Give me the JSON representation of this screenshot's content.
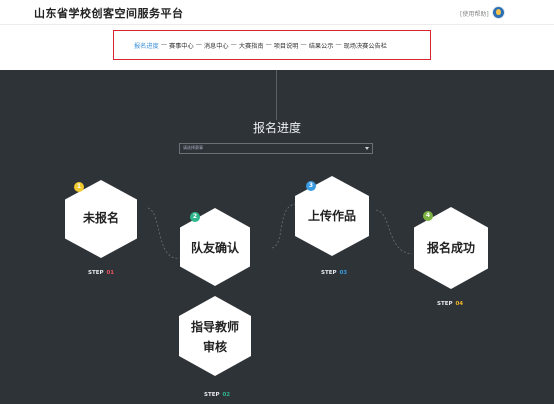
{
  "header": {
    "site_title": "山东省学校创客空间服务平台",
    "help_link": "[使用帮助]"
  },
  "nav": {
    "items": [
      {
        "label": "报名进度",
        "active": true
      },
      {
        "label": "赛事中心",
        "active": false
      },
      {
        "label": "消息中心",
        "active": false
      },
      {
        "label": "大赛指南",
        "active": false
      },
      {
        "label": "项目说明",
        "active": false
      },
      {
        "label": "结果公示",
        "active": false
      },
      {
        "label": "现场决赛公告栏",
        "active": false
      }
    ],
    "separator": "—",
    "highlight_color": "#d8262c"
  },
  "main": {
    "section_title": "报名进度",
    "select_placeholder": "请选择赛事"
  },
  "steps": [
    {
      "badge": "1",
      "label_lines": [
        "未报名"
      ],
      "step_word": "STEP",
      "step_num": "01",
      "badge_color": "#f0c92f",
      "num_color": "#e8505b"
    },
    {
      "badge": "2",
      "label_lines": [
        "队友确认"
      ],
      "step_word": "STEP",
      "step_num": "",
      "badge_color": "#2fb48c",
      "num_color": "#2fb48c"
    },
    {
      "badge": "",
      "label_lines": [
        "指导教师",
        "审核"
      ],
      "step_word": "STEP",
      "step_num": "02",
      "badge_color": "#2fb48c",
      "num_color": "#2fb48c"
    },
    {
      "badge": "3",
      "label_lines": [
        "上传作品"
      ],
      "step_word": "STEP",
      "step_num": "03",
      "badge_color": "#3a9be0",
      "num_color": "#3a9be0"
    },
    {
      "badge": "4",
      "label_lines": [
        "报名成功"
      ],
      "step_word": "STEP",
      "step_num": "04",
      "badge_color": "#7cb342",
      "num_color": "#f0b429"
    }
  ]
}
